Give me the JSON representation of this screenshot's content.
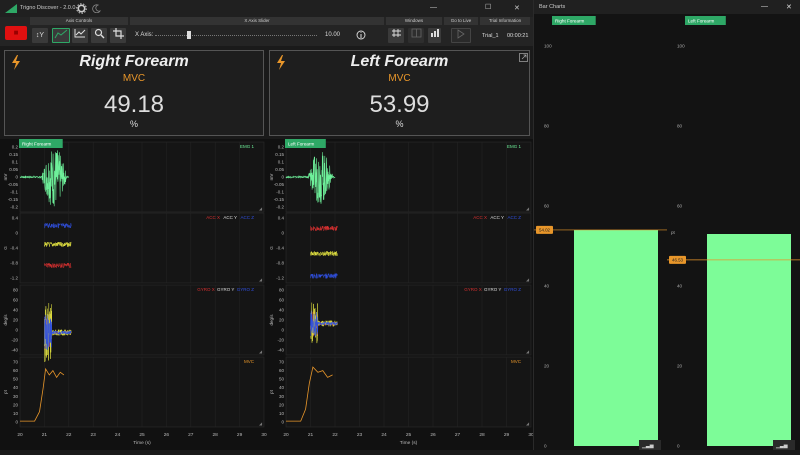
{
  "app": {
    "title": "Trigno Discover - 2.0.0",
    "minimize": "—",
    "maximize": "☐",
    "close": "✕",
    "rec": "■"
  },
  "toolbar": {
    "axis_controls": "Axis Controls",
    "x_axis_slider": "X Axis Slider",
    "windows": "Windows",
    "go_to_live": "Go to Live",
    "trial_information": "Trial Information",
    "y_btn": "↕Y",
    "x_axis_label": "X Axis:",
    "x_axis_value": "10.00",
    "trial_name": "Trial_1",
    "trial_time": "00:00:21",
    "slider_fraction": 0.2
  },
  "panels": [
    {
      "title": "Right Forearm",
      "subtitle": "MVC",
      "value": "49.18",
      "unit": "%"
    },
    {
      "title": "Left Forearm",
      "subtitle": "MVC",
      "value": "53.99",
      "unit": "%"
    }
  ],
  "graph_columns": [
    {
      "sensor_label": "Right Forearm"
    },
    {
      "sensor_label": "Left Forearm"
    }
  ],
  "plots": {
    "emg": {
      "legend": "EMG 1",
      "ylabel": "mV",
      "color": "#6ef09a",
      "ticks": [
        "0.2",
        "0.15",
        "0.1",
        "0.05",
        "0",
        "-0.05",
        "-0.1",
        "-0.15",
        "-0.2"
      ]
    },
    "acc": {
      "legend": [
        "ACC X",
        "ACC Y",
        "ACC Z"
      ],
      "ylabel": "G",
      "colors": [
        "#d83030",
        "#e0e040",
        "#3050e0"
      ],
      "ticks": [
        "0.4",
        "0",
        "-0.4",
        "-0.8",
        "-1.2"
      ]
    },
    "gyro": {
      "legend": [
        "GYRO X",
        "GYRO Y",
        "GYRO Z"
      ],
      "ylabel": "deg/s",
      "colors": [
        "#d83030",
        "#e0e040",
        "#3050e0"
      ],
      "ticks": [
        "80",
        "60",
        "40",
        "20",
        "0",
        "-20",
        "-40"
      ]
    },
    "mvc": {
      "legend": "MVC",
      "ylabel": "pt",
      "color": "#e8962a",
      "ticks": [
        "70",
        "60",
        "50",
        "40",
        "30",
        "20",
        "10",
        "0"
      ]
    }
  },
  "x_axis": {
    "label": "Time (s)",
    "ticks": [
      "20",
      "21",
      "22",
      "23",
      "24",
      "25",
      "26",
      "27",
      "28",
      "29",
      "30"
    ]
  },
  "bar_charts": {
    "title": "Bar Charts",
    "ticks": [
      "100",
      "80",
      "60",
      "40",
      "20",
      "0"
    ],
    "charts": [
      {
        "label": "Right Forearm",
        "value": 54,
        "marker": "54.02",
        "marker_value": 54.02
      },
      {
        "label": "Left Forearm",
        "value": 53,
        "marker": "46.53",
        "marker_value": 46.53
      }
    ],
    "unit": "pt"
  },
  "colors": {
    "accent": "#2ea866",
    "green": "#6ef09a",
    "orange": "#e8962a"
  }
}
